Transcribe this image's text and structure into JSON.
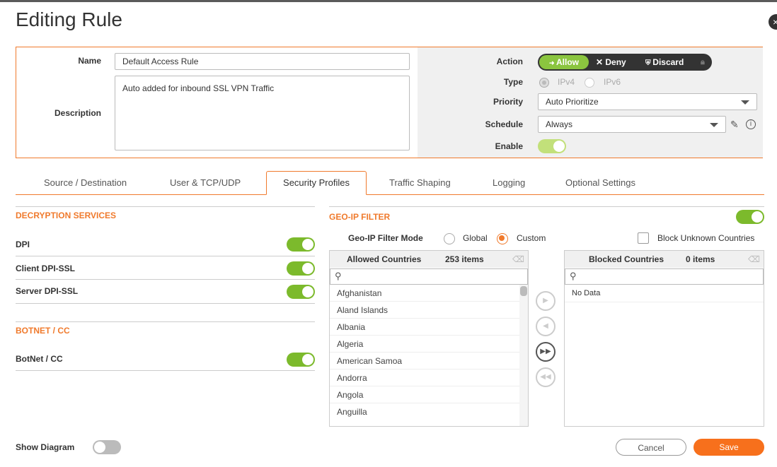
{
  "dialog": {
    "title": "Editing Rule",
    "close_label": "×"
  },
  "general": {
    "name_label": "Name",
    "name_value": "Default Access Rule",
    "description_label": "Description",
    "description_value": "Auto added for inbound SSL VPN Traffic",
    "action_label": "Action",
    "action_options": [
      "Allow",
      "Deny",
      "Discard"
    ],
    "action_selected": "Allow",
    "type_label": "Type",
    "type_options": [
      "IPv4",
      "IPv6"
    ],
    "priority_label": "Priority",
    "priority_value": "Auto Prioritize",
    "schedule_label": "Schedule",
    "schedule_value": "Always",
    "enable_label": "Enable"
  },
  "tabs": [
    "Source / Destination",
    "User & TCP/UDP",
    "Security Profiles",
    "Traffic Shaping",
    "Logging",
    "Optional Settings"
  ],
  "active_tab": "Security Profiles",
  "decryption": {
    "title": "DECRYPTION SERVICES",
    "items": [
      {
        "label": "DPI",
        "enabled": true
      },
      {
        "label": "Client DPI-SSL",
        "enabled": true
      },
      {
        "label": "Server DPI-SSL",
        "enabled": true
      }
    ]
  },
  "botnet": {
    "title": "BOTNET / CC",
    "items": [
      {
        "label": "BotNet / CC",
        "enabled": true
      }
    ]
  },
  "geoip": {
    "title": "GEO-IP FILTER",
    "enabled": true,
    "mode_label": "Geo-IP Filter Mode",
    "modes": [
      "Global",
      "Custom"
    ],
    "mode_selected": "Custom",
    "block_unknown_label": "Block Unknown Countries",
    "block_unknown_checked": false,
    "allowed": {
      "title": "Allowed Countries",
      "count": "253 items",
      "items": [
        "Afghanistan",
        "Aland Islands",
        "Albania",
        "Algeria",
        "American Samoa",
        "Andorra",
        "Angola",
        "Anguilla"
      ]
    },
    "blocked": {
      "title": "Blocked Countries",
      "count": "0 items",
      "empty_text": "No Data"
    }
  },
  "footer": {
    "show_diagram_label": "Show Diagram",
    "cancel_label": "Cancel",
    "save_label": "Save"
  },
  "colors": {
    "accent": "#f07a2c",
    "toggle_on": "#7cba2c",
    "allow": "#8bc53f"
  }
}
